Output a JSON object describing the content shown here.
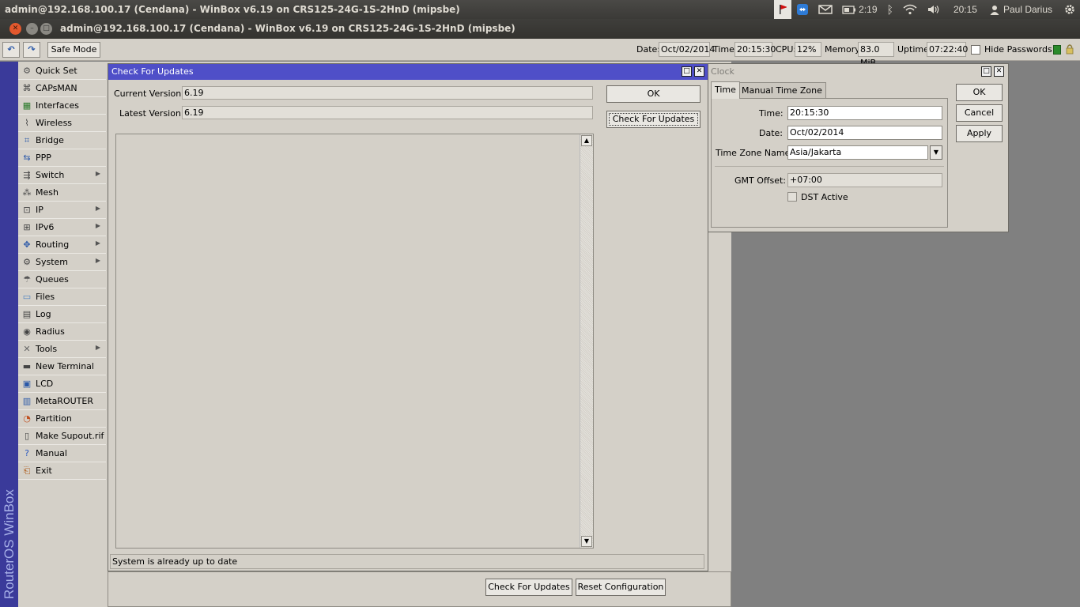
{
  "os_panel": {
    "window_title": "admin@192.168.100.17 (Cendana) - WinBox v6.19 on CRS125-24G-1S-2HnD (mipsbe)",
    "battery": "2:19",
    "clock": "20:15",
    "user": "Paul Darius"
  },
  "window": {
    "title": "admin@192.168.100.17 (Cendana) - WinBox v6.19 on CRS125-24G-1S-2HnD (mipsbe)"
  },
  "toolbar": {
    "undo_icon": "undo-icon",
    "redo_icon": "redo-icon",
    "safe_mode_label": "Safe Mode",
    "date_label": "Date:",
    "date_value": "Oct/02/2014",
    "time_label": "Time:",
    "time_value": "20:15:30",
    "cpu_label": "CPU:",
    "cpu_value": "12%",
    "memory_label": "Memory:",
    "memory_value": "83.0 MiB",
    "uptime_label": "Uptime:",
    "uptime_value": "07:22:40",
    "hide_passwords_label": "Hide Passwords",
    "hide_passwords_checked": false
  },
  "sidebar": {
    "brand": "RouterOS WinBox",
    "items": [
      {
        "label": "Quick Set",
        "icon": "quickset-icon",
        "submenu": false
      },
      {
        "label": "CAPsMAN",
        "icon": "capsman-icon",
        "submenu": false
      },
      {
        "label": "Interfaces",
        "icon": "interfaces-icon",
        "submenu": false
      },
      {
        "label": "Wireless",
        "icon": "wireless-icon",
        "submenu": false
      },
      {
        "label": "Bridge",
        "icon": "bridge-icon",
        "submenu": false
      },
      {
        "label": "PPP",
        "icon": "ppp-icon",
        "submenu": false
      },
      {
        "label": "Switch",
        "icon": "switch-icon",
        "submenu": true
      },
      {
        "label": "Mesh",
        "icon": "mesh-icon",
        "submenu": false
      },
      {
        "label": "IP",
        "icon": "ip-icon",
        "submenu": true
      },
      {
        "label": "IPv6",
        "icon": "ipv6-icon",
        "submenu": true
      },
      {
        "label": "Routing",
        "icon": "routing-icon",
        "submenu": true
      },
      {
        "label": "System",
        "icon": "system-icon",
        "submenu": true
      },
      {
        "label": "Queues",
        "icon": "queues-icon",
        "submenu": false
      },
      {
        "label": "Files",
        "icon": "files-icon",
        "submenu": false
      },
      {
        "label": "Log",
        "icon": "log-icon",
        "submenu": false
      },
      {
        "label": "Radius",
        "icon": "radius-icon",
        "submenu": false
      },
      {
        "label": "Tools",
        "icon": "tools-icon",
        "submenu": true
      },
      {
        "label": "New Terminal",
        "icon": "terminal-icon",
        "submenu": false
      },
      {
        "label": "LCD",
        "icon": "lcd-icon",
        "submenu": false
      },
      {
        "label": "MetaROUTER",
        "icon": "metarouter-icon",
        "submenu": false
      },
      {
        "label": "Partition",
        "icon": "partition-icon",
        "submenu": false
      },
      {
        "label": "Make Supout.rif",
        "icon": "supout-icon",
        "submenu": false
      },
      {
        "label": "Manual",
        "icon": "manual-icon",
        "submenu": false
      },
      {
        "label": "Exit",
        "icon": "exit-icon",
        "submenu": false
      }
    ]
  },
  "check_updates": {
    "title": "Check For Updates",
    "current_version_label": "Current Version:",
    "current_version": "6.19",
    "latest_version_label": "Latest Version:",
    "latest_version": "6.19",
    "ok_label": "OK",
    "check_label": "Check For Updates",
    "status": "System is already up to date"
  },
  "clock": {
    "title": "Clock",
    "tabs": [
      "Time",
      "Manual Time Zone"
    ],
    "active_tab": "Time",
    "time_label": "Time:",
    "time_value": "20:15:30",
    "date_label": "Date:",
    "date_value": "Oct/02/2014",
    "tz_label": "Time Zone Name:",
    "tz_value": "Asia/Jakarta",
    "gmt_label": "GMT Offset:",
    "gmt_value": "+07:00",
    "dst_label": "DST Active",
    "dst_checked": false,
    "ok_label": "OK",
    "cancel_label": "Cancel",
    "apply_label": "Apply"
  },
  "bottom": {
    "check_label": "Check For Updates",
    "reset_label": "Reset Configuration"
  },
  "colors": {
    "active_title": "#4f4fc8",
    "sidebar_strip": "#3a3a9a",
    "panel": "#d4d0c8"
  }
}
